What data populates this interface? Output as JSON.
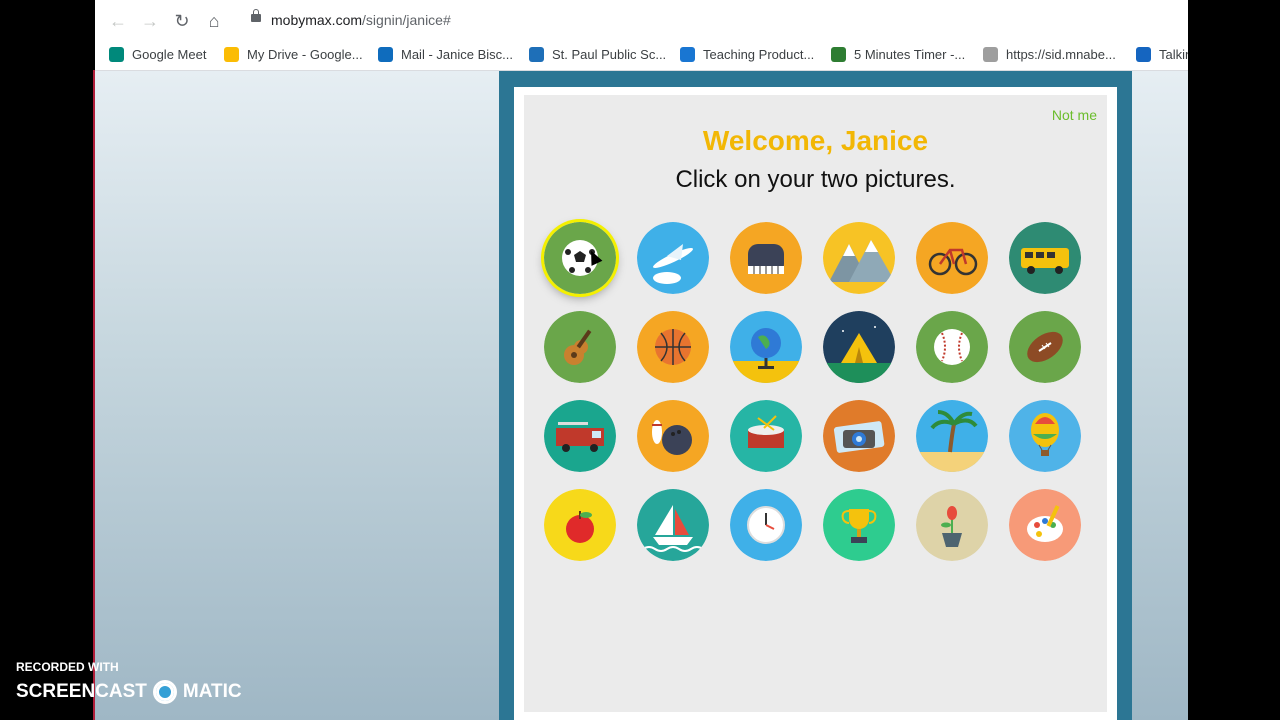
{
  "browser": {
    "url_host": "mobymax.com",
    "url_path": "/signin/janice#",
    "bookmarks": [
      {
        "label": "Google Meet",
        "color": "#00897b"
      },
      {
        "label": "My Drive - Google...",
        "color": "#fbbc04"
      },
      {
        "label": "Mail - Janice Bisc...",
        "color": "#0f6cbd"
      },
      {
        "label": "St. Paul Public Sc...",
        "color": "#1e6fb8"
      },
      {
        "label": "Teaching Product...",
        "color": "#1976d2"
      },
      {
        "label": "5 Minutes Timer -...",
        "color": "#2e7d32"
      },
      {
        "label": "https://sid.mnabe...",
        "color": "#9e9e9e"
      },
      {
        "label": "Talkin",
        "color": "#1565c0"
      }
    ]
  },
  "signin": {
    "not_me": "Not me",
    "welcome": "Welcome, Janice",
    "instruction": "Click on your two pictures.",
    "pictures": [
      {
        "name": "soccer-ball",
        "bg": "#6aa64a",
        "selected": true
      },
      {
        "name": "airplane",
        "bg": "#3fb0e8"
      },
      {
        "name": "piano",
        "bg": "#f5a623"
      },
      {
        "name": "mountains",
        "bg": "#f7c325"
      },
      {
        "name": "bicycle",
        "bg": "#f5a623"
      },
      {
        "name": "school-bus",
        "bg": "#2e8b73"
      },
      {
        "name": "guitar",
        "bg": "#6aa64a"
      },
      {
        "name": "basketball",
        "bg": "#f5a623"
      },
      {
        "name": "globe",
        "bg": "#3fb0e8"
      },
      {
        "name": "tent",
        "bg": "#1f3f5e"
      },
      {
        "name": "baseball",
        "bg": "#6aa64a"
      },
      {
        "name": "football",
        "bg": "#6aa64a"
      },
      {
        "name": "fire-truck",
        "bg": "#1aa68e"
      },
      {
        "name": "bowling",
        "bg": "#f5a623"
      },
      {
        "name": "drum",
        "bg": "#26b5a5"
      },
      {
        "name": "camera",
        "bg": "#e07b2a"
      },
      {
        "name": "palm-tree",
        "bg": "#3fb0e8"
      },
      {
        "name": "hot-air-balloon",
        "bg": "#4fb3e8"
      },
      {
        "name": "apple",
        "bg": "#f7d91a"
      },
      {
        "name": "sailboat",
        "bg": "#26a69a"
      },
      {
        "name": "clock",
        "bg": "#3fb0e8"
      },
      {
        "name": "trophy",
        "bg": "#2ecc8f"
      },
      {
        "name": "flower-pot",
        "bg": "#ded3a8"
      },
      {
        "name": "paint-palette",
        "bg": "#f79a78"
      }
    ]
  },
  "watermark": {
    "line1": "RECORDED WITH",
    "brand_left": "SCREENCAST",
    "brand_right": "MATIC"
  }
}
